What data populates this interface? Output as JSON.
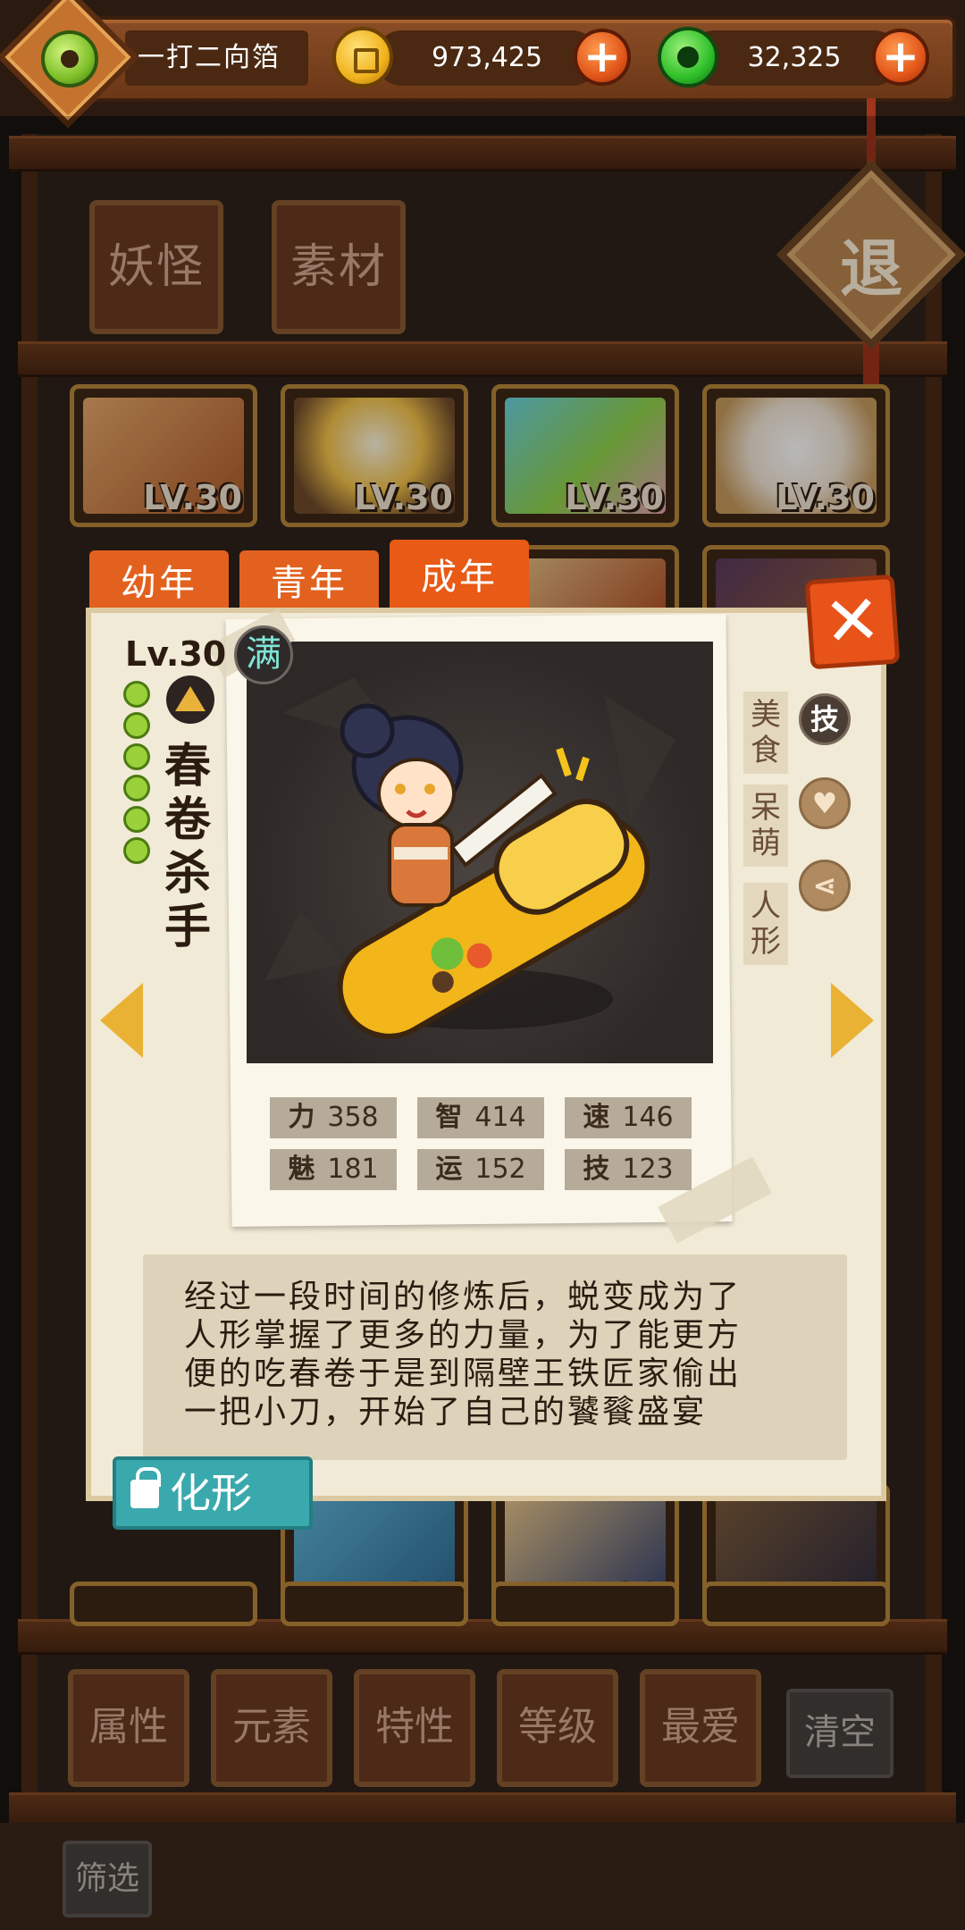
{
  "topbar": {
    "player_name": "一打二向箔",
    "gold": "973,425",
    "jade": "32,325",
    "plus_label": "+"
  },
  "category_tabs": [
    "妖怪",
    "素材"
  ],
  "exit_label": "退",
  "card_level": "LV.30",
  "filters": [
    "属性",
    "元素",
    "特性",
    "等级",
    "最爱"
  ],
  "clear_label": "清空",
  "screen_label": "筛选",
  "detail": {
    "stage_tabs": [
      "幼年",
      "青年",
      "成年"
    ],
    "active_stage": "成年",
    "level": "Lv.30",
    "full_badge": "满",
    "name": "春卷杀手",
    "tags": [
      "美食",
      "呆萌",
      "人形"
    ],
    "side_icons": [
      "技",
      "heart-icon",
      "share-icon"
    ],
    "close_label": "✕",
    "stats": [
      {
        "label": "力",
        "value": "358"
      },
      {
        "label": "智",
        "value": "414"
      },
      {
        "label": "速",
        "value": "146"
      },
      {
        "label": "魅",
        "value": "181"
      },
      {
        "label": "运",
        "value": "152"
      },
      {
        "label": "技",
        "value": "123"
      }
    ],
    "description_lines": [
      "经过一段时间的修炼后，蜕变成为了",
      "人形掌握了更多的力量，为了能更方",
      "便的吃春卷于是到隔壁王铁匠家偷出",
      "一把小刀，开始了自己的饕餮盛宴"
    ],
    "transform_label": "化形"
  },
  "colors": {
    "accent_orange": "#e85a15",
    "teal_button": "#3aa9ad",
    "paper": "#f1ead6",
    "wood": "#6b3a22"
  }
}
